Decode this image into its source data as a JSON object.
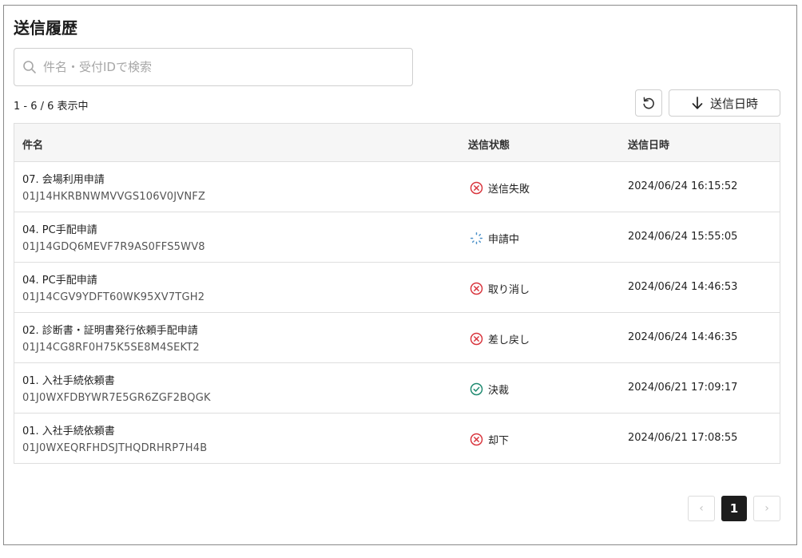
{
  "page": {
    "title": "送信履歴"
  },
  "search": {
    "placeholder": "件名・受付IDで検索",
    "value": ""
  },
  "result_count": "1 - 6 / 6 表示中",
  "toolbar": {
    "sort_label": "送信日時"
  },
  "table": {
    "headers": {
      "name": "件名",
      "status": "送信状態",
      "date": "送信日時"
    },
    "rows": [
      {
        "name": "07. 会場利用申請",
        "id": "01J14HKRBNWMVVGS106V0JVNFZ",
        "status": "送信失敗",
        "status_icon": "error-circle-icon",
        "date": "2024/06/24 16:15:52"
      },
      {
        "name": "04. PC手配申請",
        "id": "01J14GDQ6MEVF7R9AS0FFS5WV8",
        "status": "申請中",
        "status_icon": "pending-spinner-icon",
        "date": "2024/06/24 15:55:05"
      },
      {
        "name": "04. PC手配申請",
        "id": "01J14CGV9YDFT60WK95XV7TGH2",
        "status": "取り消し",
        "status_icon": "error-circle-icon",
        "date": "2024/06/24 14:46:53"
      },
      {
        "name": "02. 診断書・証明書発行依頼手配申請",
        "id": "01J14CG8RF0H75K5SE8M4SEKT2",
        "status": "差し戻し",
        "status_icon": "error-circle-icon",
        "date": "2024/06/24 14:46:35"
      },
      {
        "name": "01. 入社手続依頼書",
        "id": "01J0WXFDBYWR7E5GR6ZGF2BQGK",
        "status": "決裁",
        "status_icon": "check-circle-icon",
        "date": "2024/06/21 17:09:17"
      },
      {
        "name": "01. 入社手続依頼書",
        "id": "01J0WXEQRFHDSJTHQDRHRP7H4B",
        "status": "却下",
        "status_icon": "error-circle-icon",
        "date": "2024/06/21 17:08:55"
      }
    ]
  },
  "pagination": {
    "current": "1"
  },
  "colors": {
    "error": "#d9363e",
    "success": "#1f8a70",
    "pending": "#4a90c8",
    "pager_active": "#1d1d1d"
  }
}
